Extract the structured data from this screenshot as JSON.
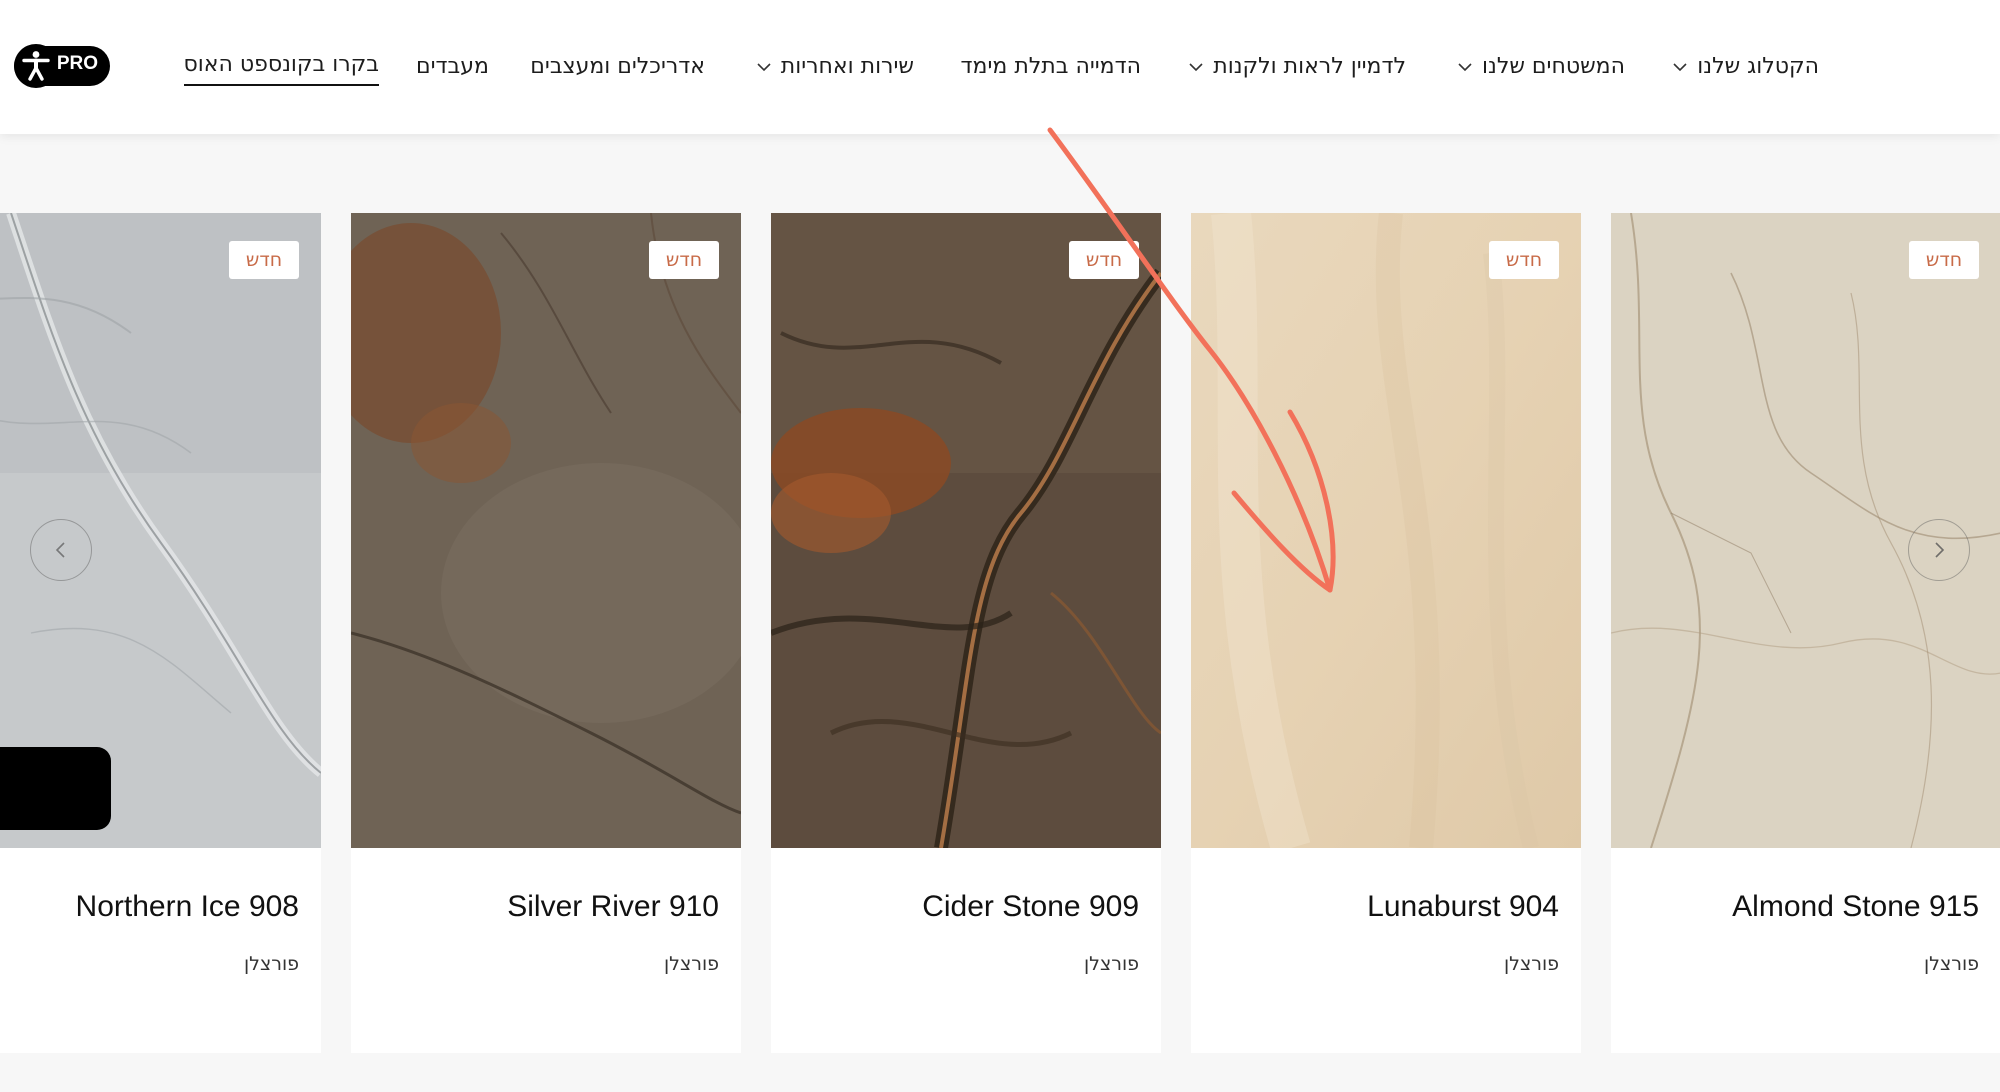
{
  "header": {
    "nav": [
      {
        "label": "הקטלוג שלנו",
        "dropdown": true
      },
      {
        "label": "המשטחים שלנו",
        "dropdown": true
      },
      {
        "label": "לדמיין לראות ולקנות",
        "dropdown": true
      },
      {
        "label": "הדמייה בתלת מימד",
        "dropdown": false
      },
      {
        "label": "שירות ואחריות",
        "dropdown": true
      },
      {
        "label": "אדריכלים ומעצבים",
        "dropdown": false
      },
      {
        "label": "מעבדים",
        "dropdown": false
      },
      {
        "label": "בקרו בקונספט האוס",
        "dropdown": false
      }
    ],
    "accessibility": {
      "pro_label": "PRO",
      "icon": "accessibility-icon"
    }
  },
  "carousel": {
    "cards": [
      {
        "name": "Almond Stone 915",
        "material": "פורצלן",
        "badge": "חדש",
        "swatch_color": "#d9d0bf"
      },
      {
        "name": "Lunaburst 904",
        "material": "פורצלן",
        "badge": "חדש",
        "swatch_color": "#e8d6bb"
      },
      {
        "name": "Cider Stone 909",
        "material": "פורצלן",
        "badge": "חדש",
        "swatch_color": "#5b4a3d"
      },
      {
        "name": "Silver River 910",
        "material": "פורצלן",
        "badge": "חדש",
        "swatch_color": "#6e6253"
      },
      {
        "name": "Northern Ice 908",
        "material": "פורצלן",
        "badge": "חדש",
        "swatch_color": "#c9ccce"
      }
    ],
    "prev_icon": "chevron-left-icon",
    "next_icon": "chevron-right-icon"
  },
  "colors": {
    "badge_text": "#c86b48",
    "annotation": "#f2715a"
  }
}
